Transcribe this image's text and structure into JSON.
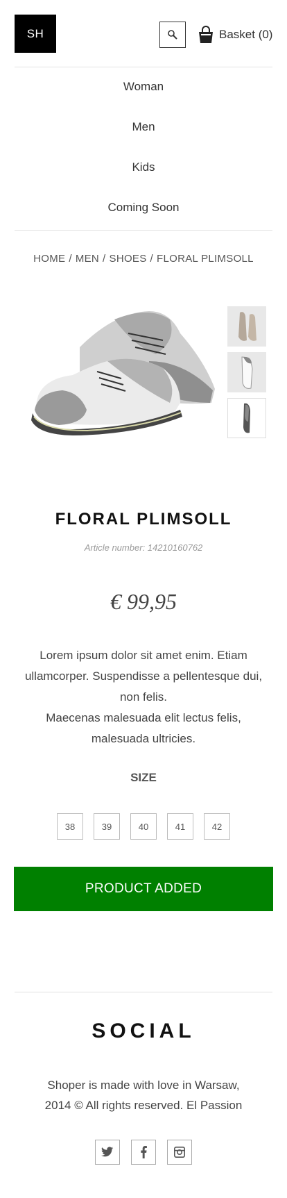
{
  "header": {
    "logo": "SH",
    "search_icon": "search-icon",
    "basket_icon": "shopping-bag-icon",
    "basket_label": "Basket (0)"
  },
  "nav": {
    "items": [
      {
        "label": "Woman"
      },
      {
        "label": "Men"
      },
      {
        "label": "Kids"
      },
      {
        "label": "Coming Soon"
      }
    ]
  },
  "breadcrumb": [
    "HOME",
    "MEN",
    "SHOES",
    "FLORAL PLIMSOLL"
  ],
  "product": {
    "title": "FLORAL PLIMSOLL",
    "article": "Article number: 14210160762",
    "price": "€ 99,95",
    "description_lines": [
      "Lorem ipsum dolor sit amet enim. Etiam",
      "ullamcorper. Suspendisse a pellentesque dui,",
      "non felis.",
      "Maecenas malesuada elit lectus felis,",
      "malesuada ultricies."
    ],
    "size_label": "SIZE",
    "sizes": [
      "38",
      "39",
      "40",
      "41",
      "42"
    ],
    "add_button_label": "PRODUCT ADDED"
  },
  "footer": {
    "social_title": "SOCIAL",
    "text_lines": [
      "Shoper is made with love in Warsaw,",
      "2014 © All rights reserved. El Passion"
    ],
    "social_icons": [
      "twitter-icon",
      "facebook-icon",
      "instagram-icon"
    ]
  },
  "colors": {
    "accent_button": "#008000",
    "logo_bg": "#000000"
  }
}
